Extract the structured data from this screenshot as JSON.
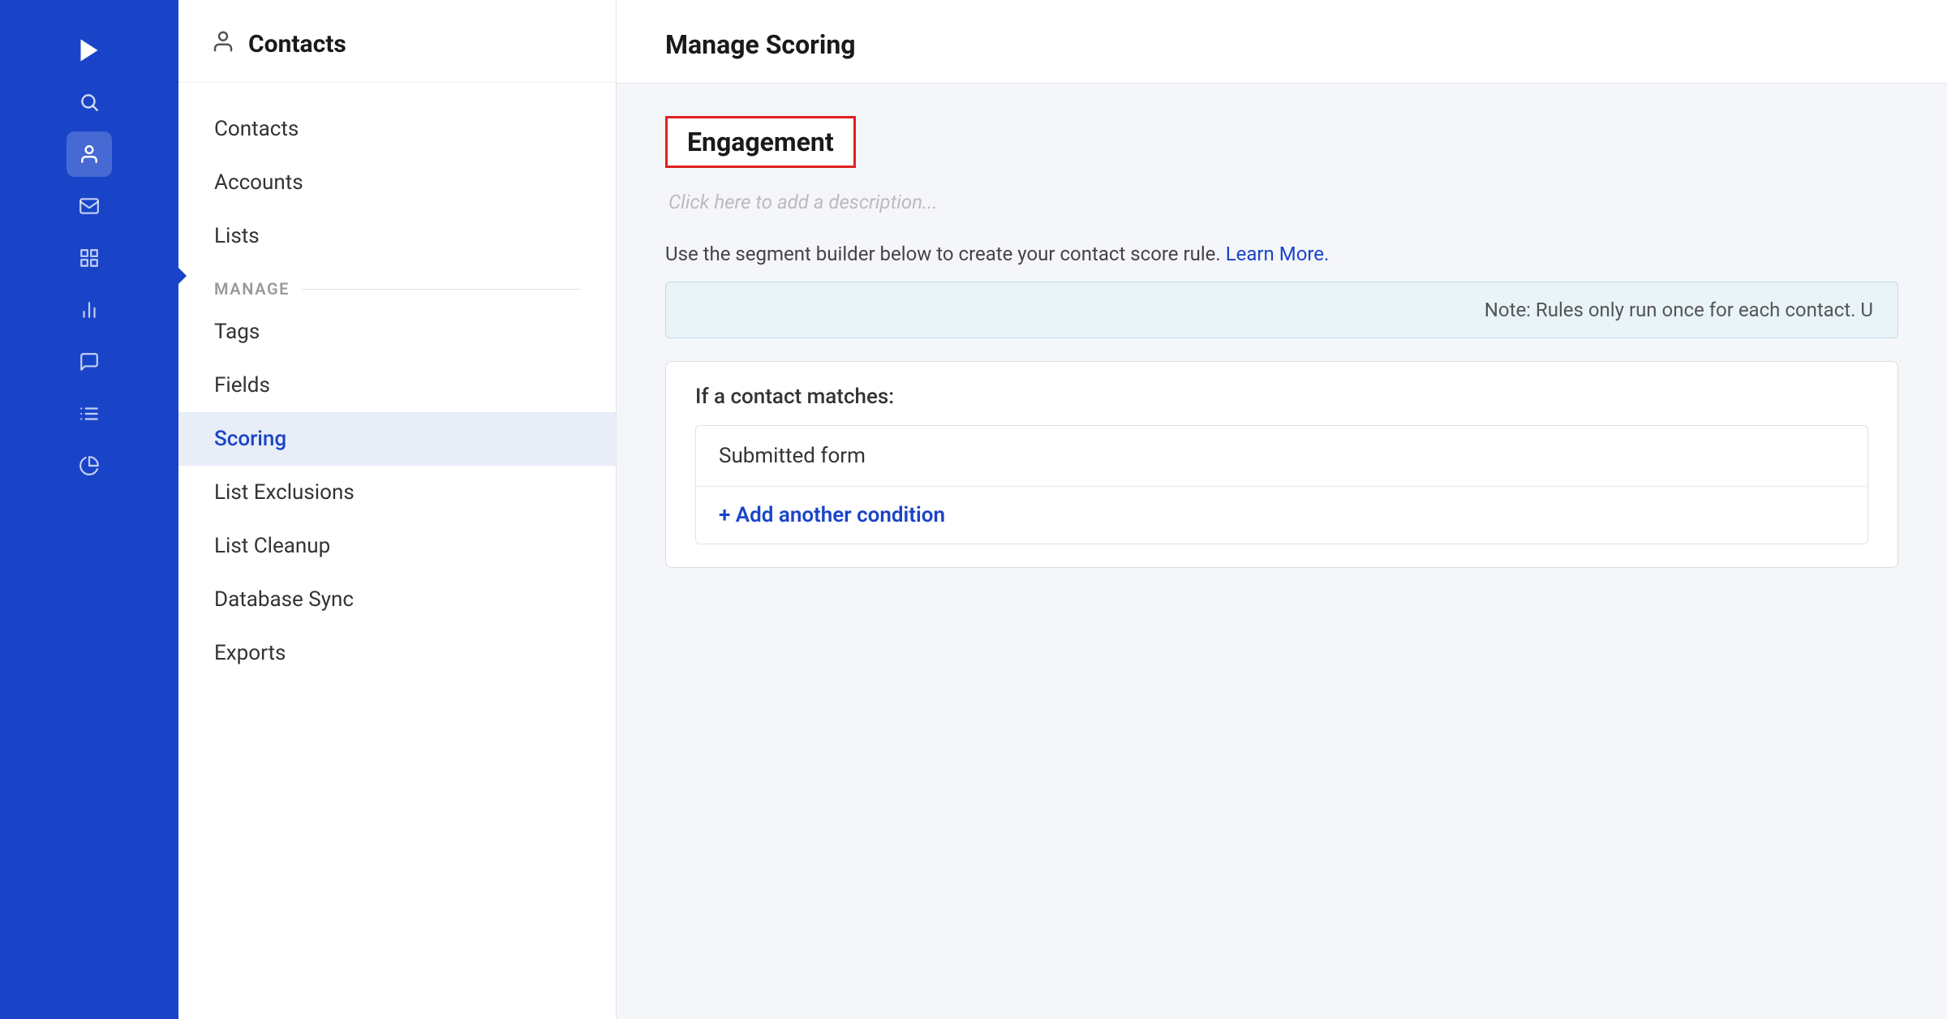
{
  "app": {
    "title": "Contacts"
  },
  "iconRail": {
    "icons": [
      {
        "name": "chevron-right-icon",
        "symbol": "❯",
        "active": false,
        "label": "Logo/Forward"
      },
      {
        "name": "search-icon",
        "symbol": "🔍",
        "active": false,
        "label": "Search"
      },
      {
        "name": "contacts-icon",
        "symbol": "👤",
        "active": true,
        "label": "Contacts"
      },
      {
        "name": "mail-icon",
        "symbol": "✉",
        "active": false,
        "label": "Mail"
      },
      {
        "name": "automation-icon",
        "symbol": "⊞",
        "active": false,
        "label": "Automation"
      },
      {
        "name": "reports-icon",
        "symbol": "▐",
        "active": false,
        "label": "Reports"
      },
      {
        "name": "messages-icon",
        "symbol": "💬",
        "active": false,
        "label": "Messages"
      },
      {
        "name": "lists-icon",
        "symbol": "☰",
        "active": false,
        "label": "Lists"
      },
      {
        "name": "analytics-icon",
        "symbol": "◑",
        "active": false,
        "label": "Analytics"
      }
    ]
  },
  "sidebar": {
    "header": {
      "title": "Contacts",
      "icon": "person"
    },
    "topItems": [
      {
        "label": "Contacts",
        "active": false
      },
      {
        "label": "Accounts",
        "active": false
      },
      {
        "label": "Lists",
        "active": false
      }
    ],
    "sectionLabel": "MANAGE",
    "manageItems": [
      {
        "label": "Tags",
        "active": false
      },
      {
        "label": "Fields",
        "active": false
      },
      {
        "label": "Scoring",
        "active": true
      },
      {
        "label": "List Exclusions",
        "active": false
      },
      {
        "label": "List Cleanup",
        "active": false
      },
      {
        "label": "Database Sync",
        "active": false
      },
      {
        "label": "Exports",
        "active": false
      }
    ]
  },
  "main": {
    "title": "Manage Scoring",
    "engagement": {
      "titleLabel": "Engagement",
      "descriptionPlaceholder": "Click here to add a description...",
      "infoText": "Use the segment builder below to create your contact score rule.",
      "learnMoreLabel": "Learn More.",
      "noteText": "Note: Rules only run once for each contact. U",
      "conditionLabel": "If a contact matches:",
      "conditionRow": "Submitted form",
      "addConditionLabel": "+ Add another condition"
    }
  }
}
